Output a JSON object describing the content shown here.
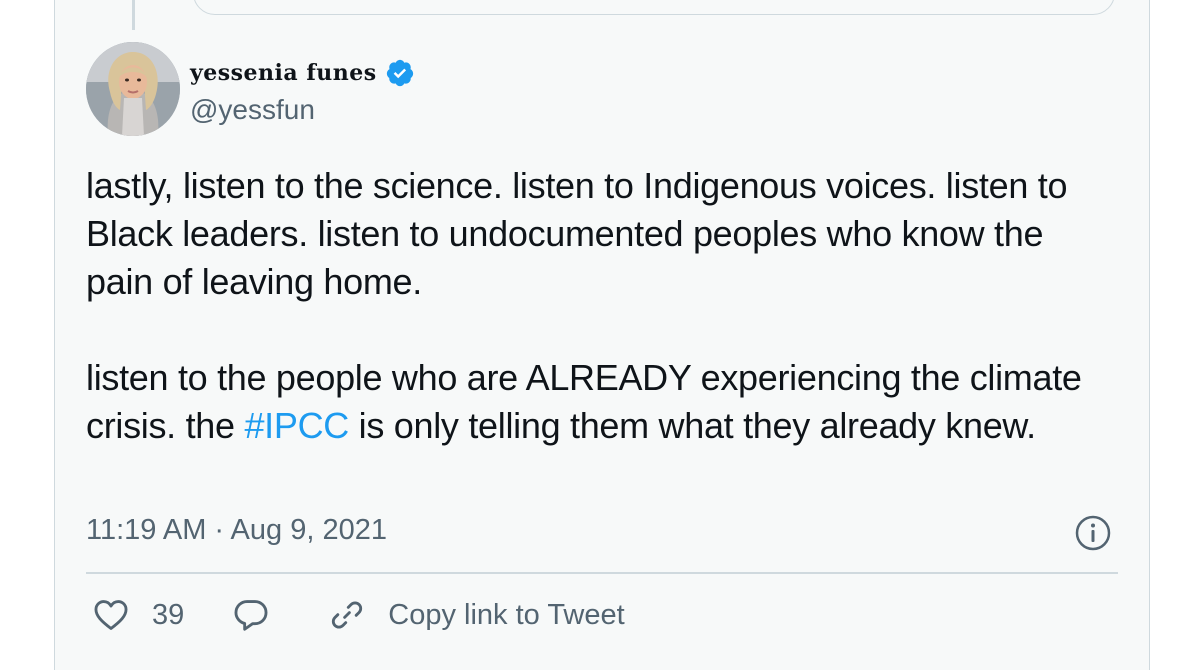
{
  "tweet": {
    "author_name": "yessenia funes",
    "author_handle": "@yessfun",
    "text_para1": "lastly, listen to the science. listen to Indigenous voices. listen to Black leaders. listen to undocumented peoples who know the pain of leaving home.",
    "text_para2_before": "listen to the people who are ALREADY experiencing the climate crisis.  the ",
    "hashtag": "#IPCC",
    "text_para2_after": " is only telling them what they already knew.",
    "timestamp": "11:19 AM · Aug 9, 2021"
  },
  "actions": {
    "like_count": "39",
    "copy_link_label": "Copy link to Tweet"
  },
  "colors": {
    "card_bg": "#f7f9f9",
    "text": "#0f1419",
    "secondary": "#536471",
    "accent": "#1d9bf0",
    "border": "#cfd9de"
  },
  "icons": [
    "verified-badge-icon",
    "info-icon",
    "heart-icon",
    "reply-icon",
    "link-icon"
  ]
}
